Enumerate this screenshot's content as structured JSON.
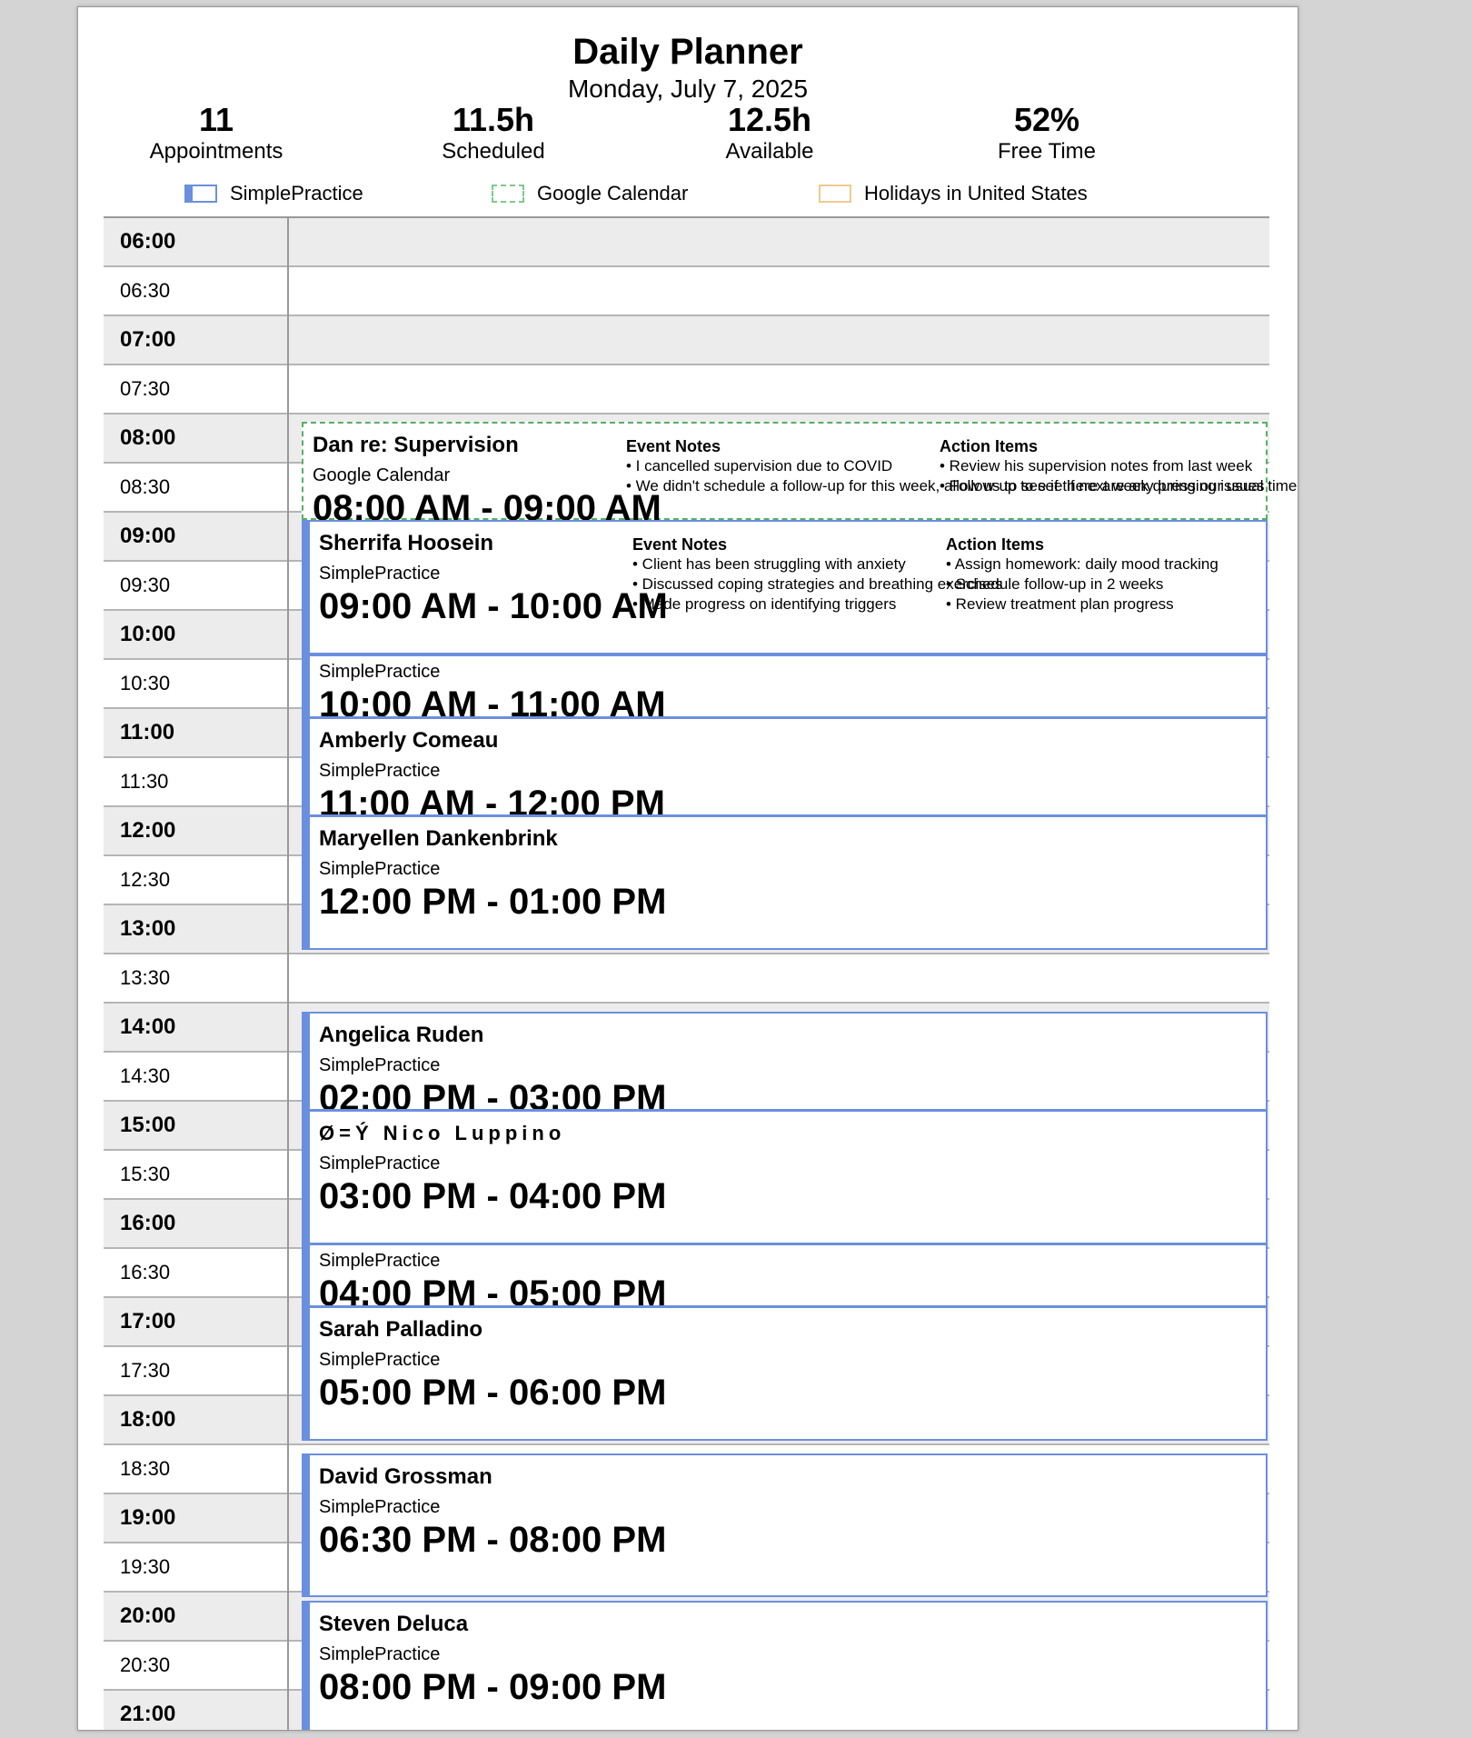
{
  "header": {
    "title": "Daily Planner",
    "date": "Monday, July 7, 2025"
  },
  "stats": [
    {
      "value": "11",
      "label": "Appointments"
    },
    {
      "value": "11.5h",
      "label": "Scheduled"
    },
    {
      "value": "12.5h",
      "label": "Available"
    },
    {
      "value": "52%",
      "label": "Free Time"
    }
  ],
  "legend": [
    {
      "label": "SimplePractice",
      "color": "#6b8fdf"
    },
    {
      "label": "Google Calendar",
      "color": "#7fc98a"
    },
    {
      "label": "Holidays in United States",
      "color": "#f3c98b"
    }
  ],
  "time_slots": [
    "06:00",
    "06:30",
    "07:00",
    "07:30",
    "08:00",
    "08:30",
    "09:00",
    "09:30",
    "10:00",
    "10:30",
    "11:00",
    "11:30",
    "12:00",
    "12:30",
    "13:00",
    "13:30",
    "14:00",
    "14:30",
    "15:00",
    "15:30",
    "16:00",
    "16:30",
    "17:00",
    "17:30",
    "18:00",
    "18:30",
    "19:00",
    "19:30",
    "20:00",
    "20:30",
    "21:00"
  ],
  "events": [
    {
      "name": "Dan re: Supervision",
      "source": "Google Calendar",
      "time": "08:00 AM - 09:00 AM",
      "notes_heading": "Event Notes",
      "notes": [
        "• I cancelled supervision due to COVID",
        "• We didn't schedule a follow-up for this week, allow us to see if there are any pressing issues"
      ],
      "actions_heading": "Action Items",
      "actions": [
        "• Review his supervision notes from last week",
        "• Follow-up to see if next week during our usual time"
      ]
    },
    {
      "name": "Sherrifa Hoosein",
      "source": "SimplePractice",
      "time": "09:00 AM - 10:00 AM",
      "notes_heading": "Event Notes",
      "notes": [
        "• Client has been struggling with anxiety",
        "• Discussed coping strategies and breathing exercises",
        "• Made progress on identifying triggers"
      ],
      "actions_heading": "Action Items",
      "actions": [
        "• Assign homework: daily mood tracking",
        "• Schedule follow-up in 2 weeks",
        "• Review treatment plan progress"
      ]
    },
    {
      "name": "",
      "source": "SimplePractice",
      "time": "10:00 AM - 11:00 AM"
    },
    {
      "name": "Amberly Comeau",
      "source": "SimplePractice",
      "time": "11:00 AM - 12:00 PM"
    },
    {
      "name": "Maryellen Dankenbrink",
      "source": "SimplePractice",
      "time": "12:00 PM - 01:00 PM"
    },
    {
      "name": "Angelica Ruden",
      "source": "SimplePractice",
      "time": "02:00 PM - 03:00 PM"
    },
    {
      "name": "Ø=Ý  Nico Luppino",
      "source": "SimplePractice",
      "time": "03:00 PM - 04:00 PM"
    },
    {
      "name": "",
      "source": "SimplePractice",
      "time": "04:00 PM - 05:00 PM"
    },
    {
      "name": "Sarah Palladino",
      "source": "SimplePractice",
      "time": "05:00 PM - 06:00 PM"
    },
    {
      "name": "David Grossman",
      "source": "SimplePractice",
      "time": "06:30 PM - 08:00 PM"
    },
    {
      "name": "Steven Deluca",
      "source": "SimplePractice",
      "time": "08:00 PM - 09:00 PM"
    }
  ]
}
